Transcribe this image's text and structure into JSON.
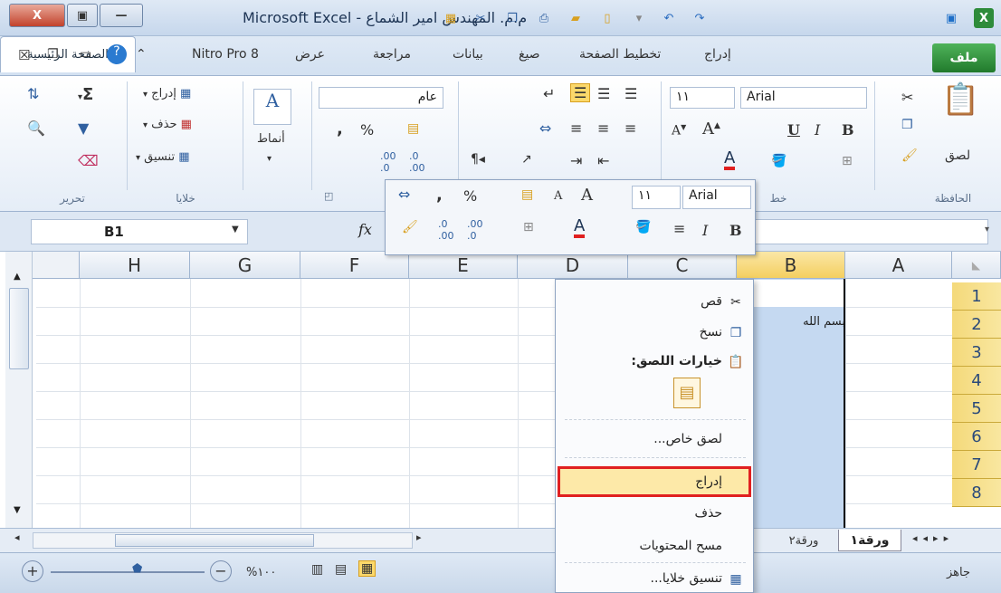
{
  "window": {
    "title_app": "Microsoft Excel - ",
    "title_doc": "م.م. المهندس امير الشماع",
    "close": "X",
    "max": "▣",
    "min": "—"
  },
  "tabs": {
    "file": "ملف",
    "home": "الصفحة الرئيسية",
    "insert": "إدراج",
    "page_layout": "تخطيط الصفحة",
    "formulas": "صيغ",
    "data": "بيانات",
    "review": "مراجعة",
    "view": "عرض",
    "nitro": "Nitro Pro 8"
  },
  "ribbon": {
    "clipboard": {
      "group": "الحافظة",
      "paste": "لصق"
    },
    "font": {
      "group": "خط",
      "name": "Arial",
      "size": "١١",
      "bold": "B",
      "italic": "I",
      "underline": "U"
    },
    "number": {
      "format": "عام",
      "percent": "%",
      "comma": ","
    },
    "styles": {
      "label": "أنماط"
    },
    "cells": {
      "group": "خلايا",
      "insert": "إدراج",
      "delete": "حذف",
      "format": "تنسيق"
    },
    "editing": {
      "group": "تحرير",
      "sum": "Σ"
    }
  },
  "formula_bar": {
    "name_box": "B1",
    "fx": "fx"
  },
  "mini_toolbar": {
    "font": "Arial",
    "size": "١١",
    "percent": "%",
    "comma": ",",
    "bold": "B",
    "italic": "I"
  },
  "columns": [
    "A",
    "B",
    "C",
    "D",
    "E",
    "F",
    "G",
    "H"
  ],
  "rows": [
    "1",
    "2",
    "3",
    "4",
    "5",
    "6",
    "7",
    "8"
  ],
  "cells": {
    "B2": "بسم الله"
  },
  "context_menu": {
    "cut": "قص",
    "copy": "نسخ",
    "paste_options": "خيارات اللصق:",
    "paste_special": "لصق خاص...",
    "insert": "إدراج",
    "delete": "حذف",
    "clear_contents": "مسح المحتويات",
    "format_cells": "تنسيق خلايا..."
  },
  "sheets": {
    "active": "ورقة١",
    "other": "ورقة٢"
  },
  "status": {
    "ready": "جاهز",
    "zoom": "%١٠٠"
  }
}
